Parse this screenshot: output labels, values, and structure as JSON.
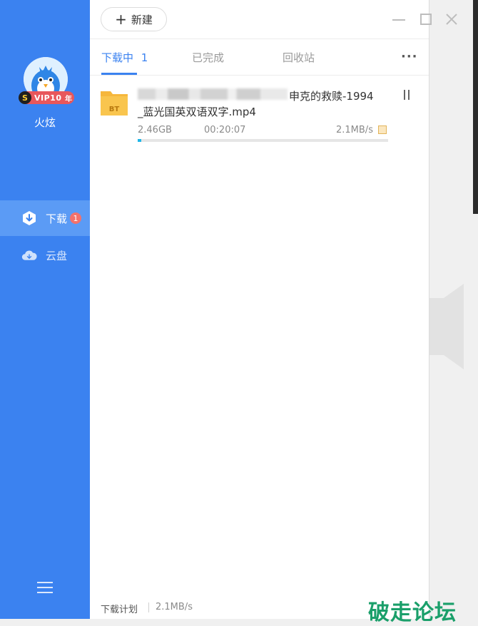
{
  "toolbar": {
    "new_label": "新建"
  },
  "user": {
    "name": "火炫",
    "vip": {
      "s": "S",
      "text": "VIP10",
      "year": "年"
    }
  },
  "sidebar": {
    "items": [
      {
        "label": "下载",
        "badge": "1"
      },
      {
        "label": "云盘"
      }
    ]
  },
  "tabs": [
    {
      "label": "下载中",
      "count": "1"
    },
    {
      "label": "已完成"
    },
    {
      "label": "回收站"
    }
  ],
  "more_label": "···",
  "download": {
    "file_type": "BT",
    "title_line1": "申克的救赎-1994",
    "title_line2": "_蓝光国英双语双字.mp4",
    "size": "2.46GB",
    "time": "00:20:07",
    "speed": "2.1MB/s",
    "progress": 0.015
  },
  "footer": {
    "plan_label": "下载计划",
    "speed": "2.1MB/s"
  },
  "watermark": "破走论坛",
  "colors": {
    "sidebar": "#3b82f0",
    "accent": "#3b82f0",
    "progress": "#1fb6e8",
    "badge": "#f3716b",
    "watermark": "#1a9f6a"
  }
}
